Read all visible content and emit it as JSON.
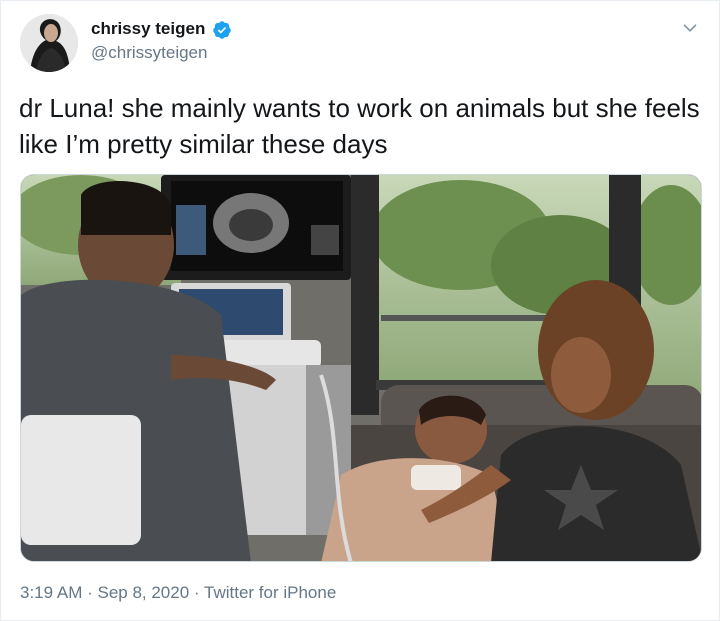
{
  "user": {
    "display_name": "chrissy teigen",
    "handle": "@chrissyteigen",
    "verified": true,
    "verified_color": "#1da1f2"
  },
  "tweet": {
    "text": "dr Luna! she mainly wants to work on animals but she feels like I’m pretty similar these days"
  },
  "meta": {
    "time": "3:19 AM",
    "separator": " · ",
    "date": "Sep 8, 2020",
    "source": "Twitter for iPhone"
  },
  "icons": {
    "verified": "verified-badge-icon",
    "caret": "chevron-down-icon"
  },
  "colors": {
    "text": "#14171a",
    "secondary": "#657786",
    "border": "#e6ecf0",
    "accent": "#1da1f2"
  }
}
